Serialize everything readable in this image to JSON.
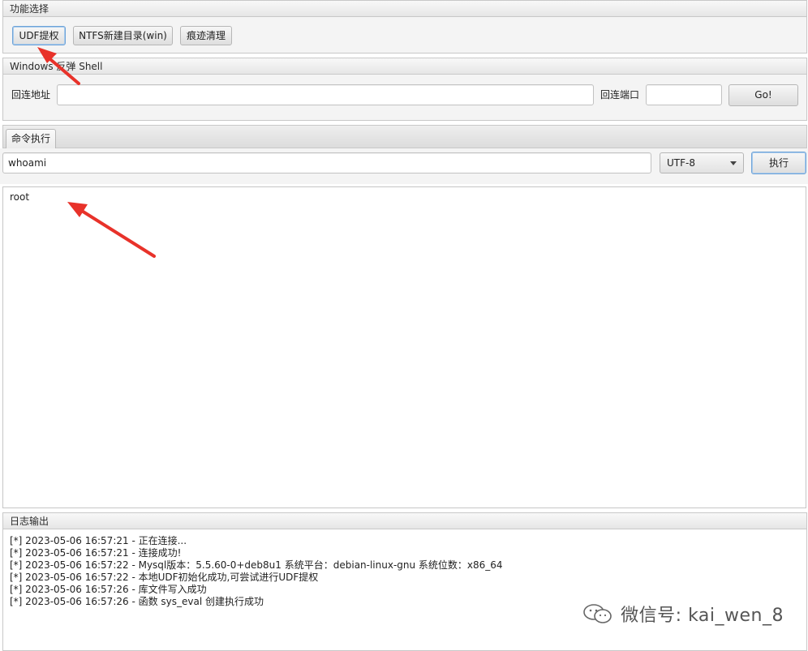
{
  "function_panel": {
    "title": "功能选择",
    "buttons": [
      "UDF提权",
      "NTFS新建目录(win)",
      "痕迹清理"
    ]
  },
  "shell_panel": {
    "title": "Windows 反弹 Shell",
    "address_label": "回连地址",
    "address_value": "",
    "port_label": "回连端口",
    "port_value": "",
    "go_label": "Go!"
  },
  "command": {
    "tab_label": "命令执行",
    "input_value": "whoami",
    "encoding": "UTF-8",
    "execute_label": "执行",
    "output": "root"
  },
  "log": {
    "title": "日志输出",
    "lines": [
      "[*] 2023-05-06 16:57:21 - 正在连接...",
      "[*] 2023-05-06 16:57:21 - 连接成功!",
      "[*] 2023-05-06 16:57:22 - Mysql版本：5.5.60-0+deb8u1 系统平台：debian-linux-gnu 系统位数：x86_64",
      "[*] 2023-05-06 16:57:22 - 本地UDF初始化成功,可尝试进行UDF提权",
      "[*] 2023-05-06 16:57:26 - 库文件写入成功",
      "[*] 2023-05-06 16:57:26 - 函数 sys_eval 创建执行成功"
    ]
  },
  "watermark": "微信号: kai_wen_8",
  "colors": {
    "annotation_arrow": "#e8322a"
  }
}
